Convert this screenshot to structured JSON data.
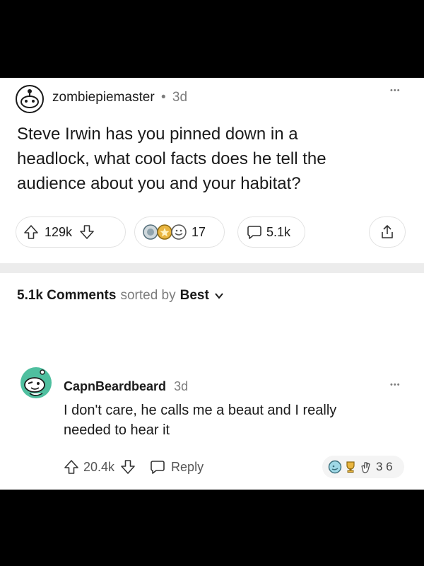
{
  "post": {
    "username": "zombiepiemaster",
    "dot": "•",
    "age": "3d",
    "more": "•••",
    "title_lines": [
      "Steve Irwin has you pinned down in a",
      "headlock, what cool facts does he tell the",
      "audience about you and your habitat?"
    ],
    "upvotes": "129k",
    "awards_count": "17",
    "comments": "5.1k"
  },
  "sort": {
    "count": "5.1k Comments",
    "sorted_by": "sorted by",
    "mode": "Best"
  },
  "comment": {
    "username": "CapnBeardbeard",
    "age": "3d",
    "more": "•••",
    "text_lines": [
      "I don't care, he calls me a beaut and I really",
      "needed to hear it"
    ],
    "upvotes": "20.4k",
    "reply_label": "Reply",
    "awards_count": "3 6"
  },
  "colors": {
    "divider": "#e9e9e9",
    "award_gold": "#e9b53f",
    "award_green": "#4fbf9f"
  }
}
